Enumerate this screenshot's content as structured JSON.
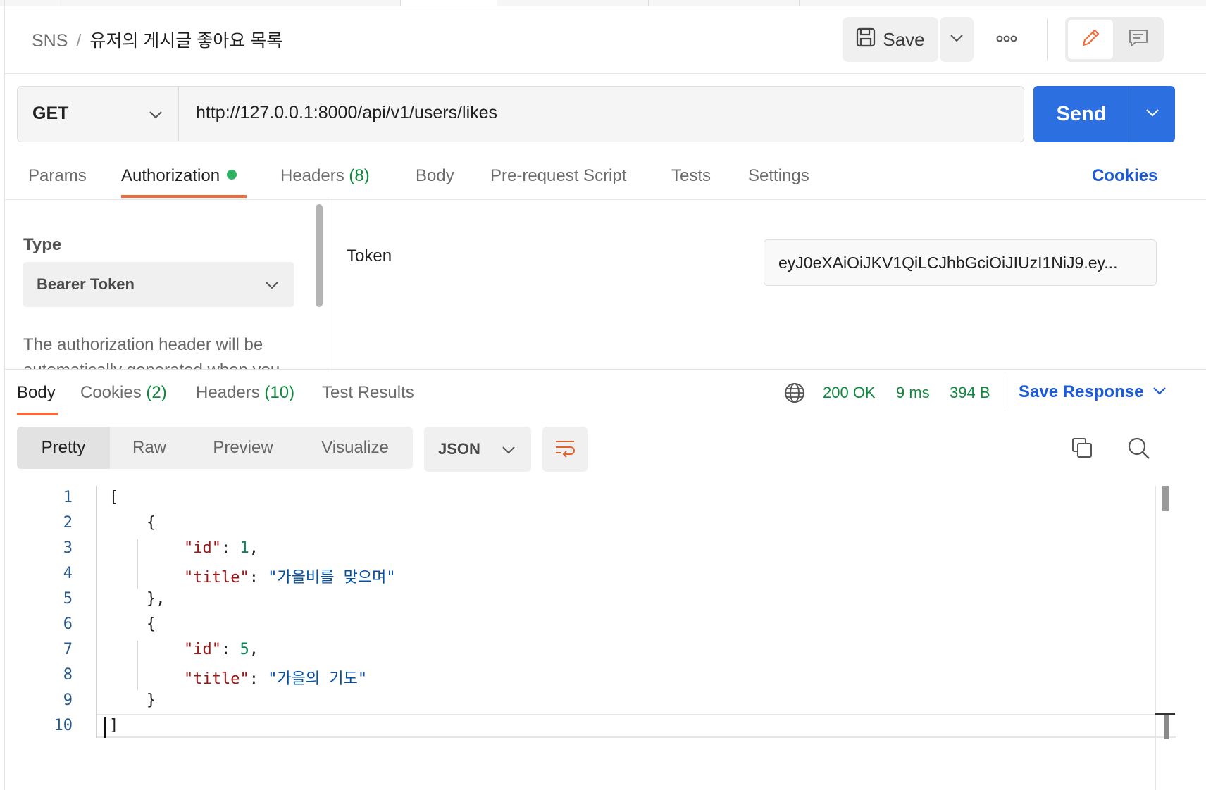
{
  "breadcrumb": {
    "collection": "SNS",
    "separator": "/",
    "request": "유저의 게시글 좋아요 목록"
  },
  "toolbar": {
    "save_label": "Save"
  },
  "request": {
    "method": "GET",
    "url": "http://127.0.0.1:8000/api/v1/users/likes",
    "send_label": "Send"
  },
  "request_tabs": [
    {
      "label": "Params"
    },
    {
      "label": "Authorization"
    },
    {
      "label": "Headers",
      "count": "(8)"
    },
    {
      "label": "Body"
    },
    {
      "label": "Pre-request Script"
    },
    {
      "label": "Tests"
    },
    {
      "label": "Settings"
    }
  ],
  "cookies_link": "Cookies",
  "auth": {
    "type_label": "Type",
    "type_value": "Bearer Token",
    "description": "The authorization header will be automatically generated when you send the request.",
    "token_label": "Token",
    "token_value": "eyJ0eXAiOiJKV1QiLCJhbGciOiJIUzI1NiJ9.ey..."
  },
  "response_tabs": [
    {
      "label": "Body"
    },
    {
      "label": "Cookies",
      "count": "(2)"
    },
    {
      "label": "Headers",
      "count": "(10)"
    },
    {
      "label": "Test Results"
    }
  ],
  "status": {
    "code": "200 OK",
    "time": "9 ms",
    "size": "394 B"
  },
  "save_response_label": "Save Response",
  "view_modes": [
    "Pretty",
    "Raw",
    "Preview",
    "Visualize"
  ],
  "format": "JSON",
  "code_lines": [
    "1",
    "2",
    "3",
    "4",
    "5",
    "6",
    "7",
    "8",
    "9",
    "10"
  ],
  "json": {
    "k_id": "\"id\"",
    "k_title": "\"title\"",
    "id1": "1",
    "title1": "\"가을비를 맞으며\"",
    "id2": "5",
    "title2": "\"가을의 기도\""
  },
  "icons": {
    "save": "floppy-disk-icon",
    "more": "ellipsis-icon",
    "edit": "pencil-icon",
    "comment": "comment-icon",
    "globe": "globe-icon",
    "wrap": "wrap-lines-icon",
    "copy": "copy-icon",
    "search": "search-icon"
  },
  "colors": {
    "accent": "#f26b3a",
    "send": "#2b6fe0",
    "link": "#1d5bd6",
    "success": "#0e8a3d"
  }
}
